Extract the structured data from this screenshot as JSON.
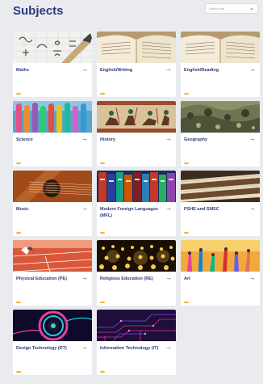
{
  "header": {
    "title": "Subjects",
    "filter": {
      "selected": "Select one",
      "chevron": "⌄"
    }
  },
  "arrow_glyph": "→",
  "accent_color": "#f2b632",
  "title_color": "#2d3a7c",
  "subjects": [
    {
      "label": "Maths",
      "image": "maths-equations-image"
    },
    {
      "label": "English/Writing",
      "image": "open-book-image"
    },
    {
      "label": "English/Reading",
      "image": "open-book-image"
    },
    {
      "label": "Science",
      "image": "test-tubes-image"
    },
    {
      "label": "History",
      "image": "tapestry-image"
    },
    {
      "label": "Geography",
      "image": "terrain-image"
    },
    {
      "label": "Music",
      "image": "guitar-image"
    },
    {
      "label": "Modern Foreign Languages (MFL)",
      "image": "dictionaries-image"
    },
    {
      "label": "PSHE and SMSC",
      "image": "books-stack-image"
    },
    {
      "label": "Physical Education (PE)",
      "image": "running-track-image"
    },
    {
      "label": "Religious Education (RE)",
      "image": "candles-image"
    },
    {
      "label": "Art",
      "image": "painted-hands-image"
    },
    {
      "label": "Design Technology (DT)",
      "image": "camera-lens-image"
    },
    {
      "label": "Information Technology (IT)",
      "image": "circuit-board-image"
    }
  ]
}
